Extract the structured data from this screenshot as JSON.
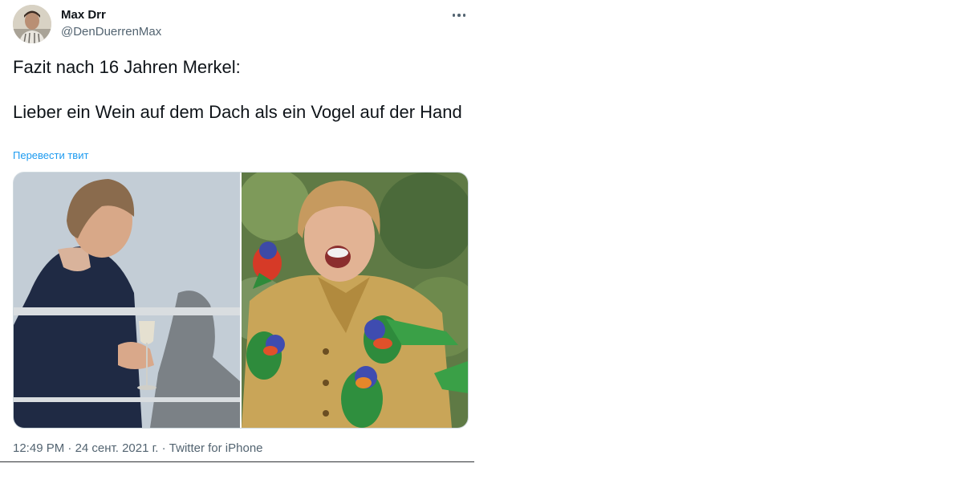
{
  "user": {
    "display_name": "Max Drr",
    "handle": "@DenDuerrenMax"
  },
  "tweet": {
    "text": "Fazit nach 16 Jahren Merkel:\n\nLieber ein Wein auf dem Dach als ein Vogel auf der Hand",
    "translate_label": "Перевести твит",
    "time": "12:49 PM",
    "separator": "·",
    "date": "24 сент. 2021 г.",
    "source": "Twitter for iPhone"
  },
  "icons": {
    "more": "more-horizontal-icon"
  },
  "colors": {
    "link": "#1d9bf0",
    "secondary_text": "#536471",
    "primary_text": "#0f1419"
  }
}
